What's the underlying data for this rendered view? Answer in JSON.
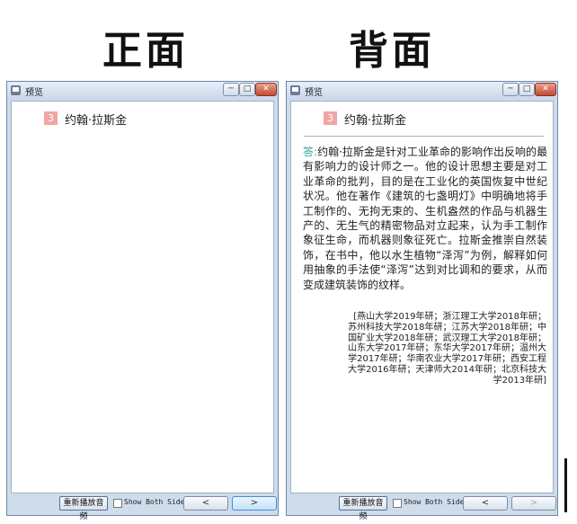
{
  "labels": {
    "front": "正面",
    "back": "背面"
  },
  "window": {
    "title": "预览",
    "minimize": "─",
    "restore": "□",
    "close": "✕"
  },
  "card": {
    "number": "3",
    "term": "约翰·拉斯金",
    "answer_label": "答:",
    "answer_text": "约翰·拉斯金是针对工业革命的影响作出反响的最有影响力的设计师之一。他的设计思想主要是对工业革命的批判，目的是在工业化的英国恢复中世纪状况。他在著作《建筑的七盏明灯》中明确地将手工制作的、无拘无束的、生机盎然的作品与机器生产的、无生气的精密物品对立起来，认为手工制作象征生命，而机器则象征死亡。拉斯金推崇自然装饰，在书中，他以水生植物“泽泻”为例，解释如何用抽象的手法使“泽泻”达到对比调和的要求，从而变成建筑装饰的纹样。",
    "sources": "[燕山大学2019年研；浙江理工大学2018年研；苏州科技大学2018年研；江苏大学2018年研；中国矿业大学2018年研；武汉理工大学2018年研；山东大学2017年研；东华大学2017年研；温州大学2017年研；华南农业大学2017年研；西安工程大学2016年研；天津师大2014年研；北京科技大学2013年研]"
  },
  "controls": {
    "replay": "重新播放音频",
    "show_both": "Show Both Sides",
    "prev": "<",
    "next": ">"
  },
  "colors": {
    "badge": "#f2a5a5",
    "answer_label": "#3aa6a0",
    "titlebar": "#c9d7ea"
  }
}
